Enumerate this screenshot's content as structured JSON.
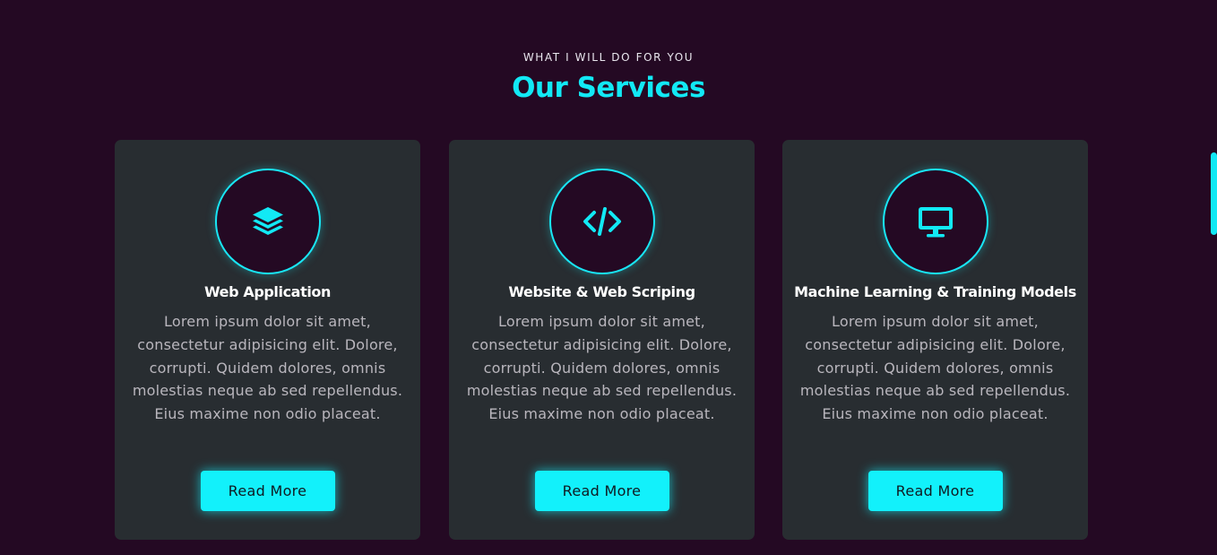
{
  "section": {
    "eyebrow": "WHAT I WILL DO FOR YOU",
    "title": "Our Services"
  },
  "services": [
    {
      "icon": "layers-icon",
      "title": "Web Application",
      "description": "Lorem ipsum dolor sit amet, consectetur adipisicing elit. Dolore, corrupti. Quidem dolores, omnis molestias neque ab sed repellendus. Eius maxime non odio placeat.",
      "button_label": "Read More"
    },
    {
      "icon": "code-icon",
      "title": "Website & Web Scriping",
      "description": "Lorem ipsum dolor sit amet, consectetur adipisicing elit. Dolore, corrupti. Quidem dolores, omnis molestias neque ab sed repellendus. Eius maxime non odio placeat.",
      "button_label": "Read More"
    },
    {
      "icon": "desktop-icon",
      "title": "Machine Learning & Training Models",
      "description": "Lorem ipsum dolor sit amet, consectetur adipisicing elit. Dolore, corrupti. Quidem dolores, omnis molestias neque ab sed repellendus. Eius maxime non odio placeat.",
      "button_label": "Read More"
    }
  ],
  "colors": {
    "background": "#240923",
    "card": "#282d31",
    "accent": "#12e9f5",
    "button_text": "#0f1a22",
    "body_text": "#b9b6bd"
  }
}
